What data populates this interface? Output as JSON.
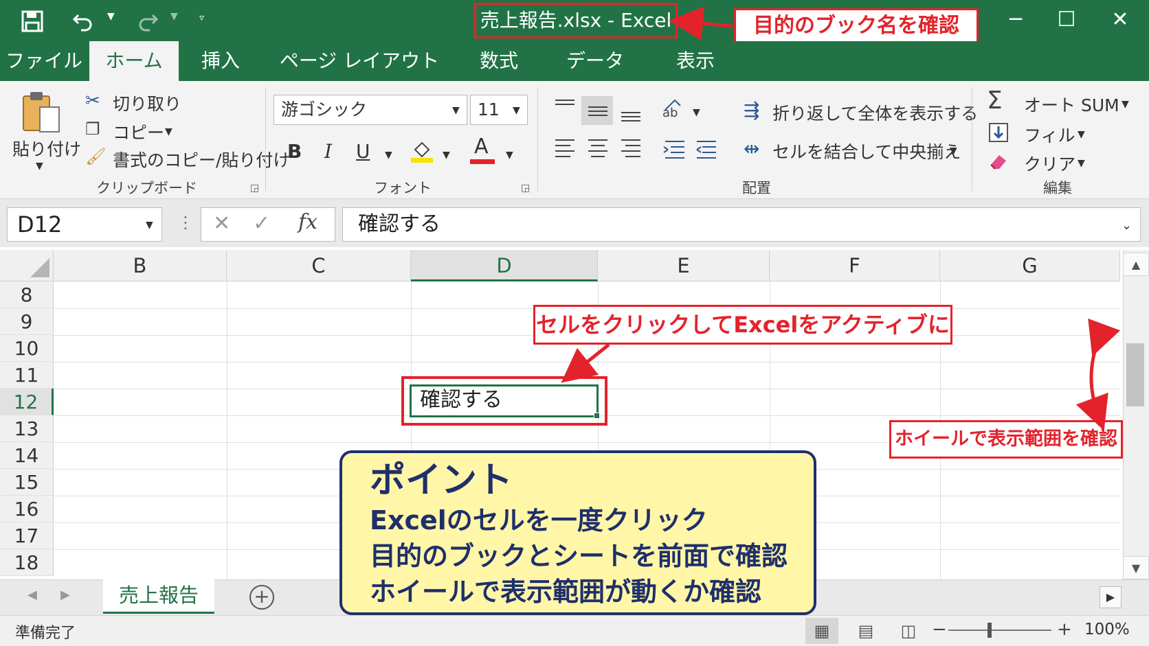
{
  "window": {
    "title": "売上報告.xlsx - Excel",
    "quick_access": {
      "save_icon": "save-icon",
      "undo_icon": "undo-icon",
      "redo_icon": "redo-icon",
      "customize_icon": "customize-icon"
    },
    "controls": {
      "minimize": "─",
      "maximize": "☐",
      "close": "✕"
    }
  },
  "tabs": [
    "ファイル",
    "ホーム",
    "挿入",
    "ページ レイアウト",
    "数式",
    "データ",
    "表示"
  ],
  "active_tab": "ホーム",
  "ribbon": {
    "clipboard": {
      "paste": "貼り付け",
      "cut": "切り取り",
      "copy": "コピー",
      "format_painter": "書式のコピー/貼り付け",
      "label": "クリップボード"
    },
    "font": {
      "font_name": "游ゴシック",
      "font_size": "11",
      "bold": "B",
      "italic": "I",
      "underline": "U",
      "font_color": "A",
      "label": "フォント",
      "font_color_hex": "#e3232b",
      "fill_color_hex": "#f5e400"
    },
    "alignment": {
      "wrap_text": "折り返して全体を表示する",
      "merge_center": "セルを結合して中央揃え",
      "label": "配置"
    },
    "editing": {
      "autosum": "オート SUM",
      "fill": "フィル",
      "clear": "クリア",
      "label": "編集"
    }
  },
  "formula_bar": {
    "name_box": "D12",
    "fx": "fx",
    "content": "確認する"
  },
  "grid": {
    "columns": [
      "B",
      "C",
      "D",
      "E",
      "F",
      "G"
    ],
    "selected_column": "D",
    "rows": [
      "8",
      "9",
      "10",
      "11",
      "12",
      "13",
      "14",
      "15",
      "16",
      "17",
      "18"
    ],
    "selected_row": "12",
    "active_cell_value": "確認する"
  },
  "sheets": [
    "売上報告"
  ],
  "status": {
    "text": "準備完了",
    "zoom": "100%"
  },
  "annotations": {
    "book_name": "目的のブック名を確認",
    "click_cell": "セルをクリックしてExcelをアクティブに",
    "wheel": "ホイールで表示範囲を確認"
  },
  "point_box": {
    "title": "ポイント",
    "lines": [
      "Excelのセルを一度クリック",
      "目的のブックとシートを前面で確認",
      "ホイールで表示範囲が動くか確認"
    ]
  },
  "colors": {
    "excel_green": "#217346",
    "callout_red": "#e3232b",
    "point_bg": "#fff6a8",
    "point_text": "#1f2f6a"
  }
}
